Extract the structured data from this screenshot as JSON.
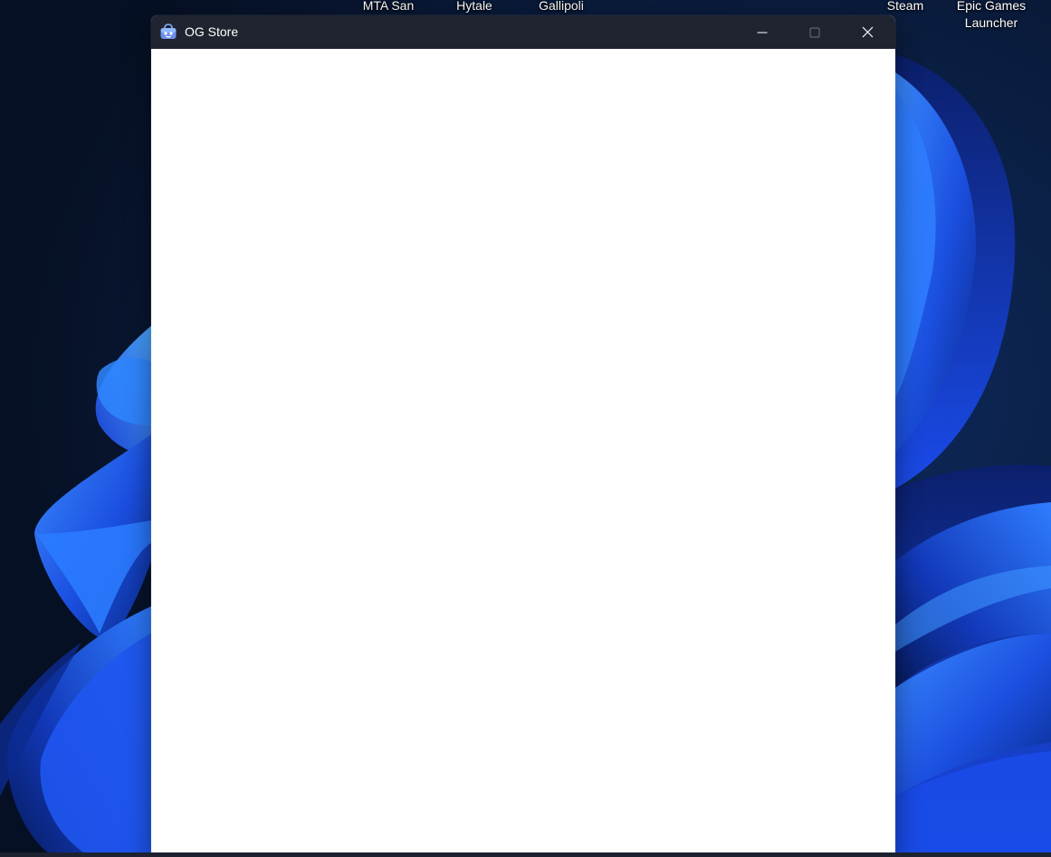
{
  "desktop": {
    "icons": [
      {
        "label": "MTA San"
      },
      {
        "label": "Hytale"
      },
      {
        "label": "Gallipoli"
      },
      {
        "label": "Steam"
      },
      {
        "label": "Epic Games Launcher"
      }
    ]
  },
  "window": {
    "title": "OG Store",
    "app_icon": "store-bag-icon",
    "controls": {
      "minimize": "minimize-icon",
      "maximize": "maximize-icon",
      "close": "close-icon"
    }
  },
  "colors": {
    "title_bar": "#1f2430",
    "content_background": "#ffffff",
    "wallpaper_dark": "#08162e",
    "wallpaper_accent": "#1e5cff"
  }
}
